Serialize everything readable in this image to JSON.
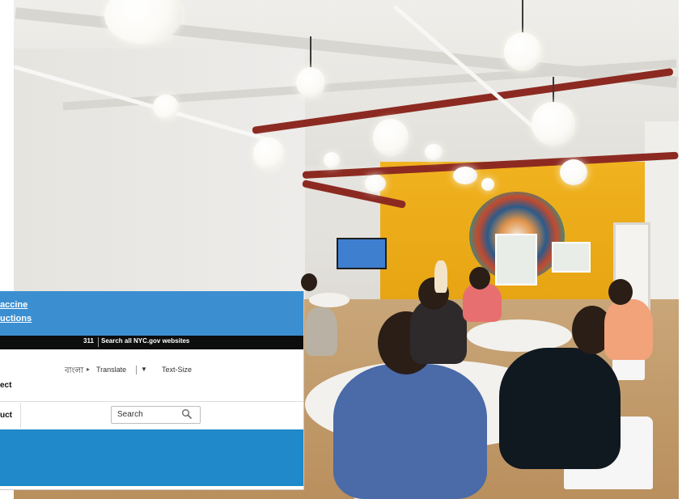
{
  "overlay": {
    "header_link_line1": "accine",
    "header_link_line2": "uctions",
    "top_bar": {
      "phone": "311",
      "search_all": "Search all NYC.gov websites"
    },
    "language_bar": {
      "bengali": "বাংলা",
      "translate": "Translate",
      "caret": "▼",
      "text_size": "Text-Size"
    },
    "fragment_1": "ect",
    "fragment_2": "uct",
    "search": {
      "placeholder": "Search",
      "icon": "search-icon"
    },
    "colors": {
      "header_blue": "#3b8fd1",
      "top_bar_black": "#0d0d0d",
      "band_blue": "#1f89c9"
    }
  },
  "photo": {
    "description_icon": "photograph"
  }
}
